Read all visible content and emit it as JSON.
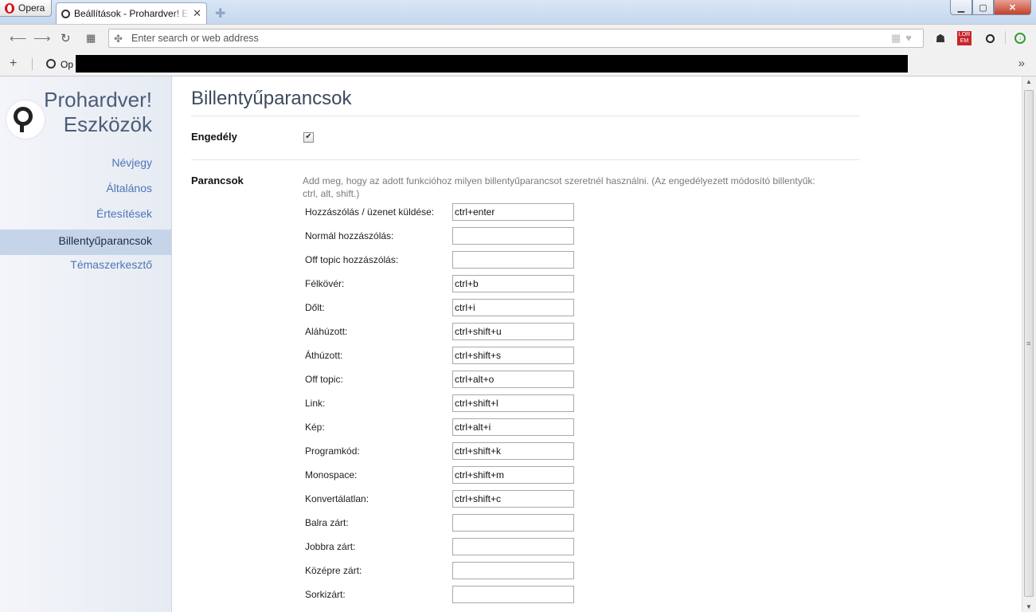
{
  "browser": {
    "opera_label": "Opera",
    "tab_title": "Beállítások - Prohardver! Eszközök",
    "address_placeholder": "Enter search or web address",
    "bookmark_text": "Op",
    "ext_lor_label": "LOR EM"
  },
  "sidebar": {
    "brand_line1": "Prohardver!",
    "brand_line2": "Eszközök",
    "items": [
      {
        "label": "Névjegy",
        "active": false
      },
      {
        "label": "Általános",
        "active": false
      },
      {
        "label": "Értesítések",
        "active": false
      },
      {
        "label": "Billentyűparancsok",
        "active": true
      },
      {
        "label": "Témaszerkesztő",
        "active": false
      }
    ]
  },
  "main": {
    "title": "Billentyűparancsok",
    "enable_label": "Engedély",
    "enable_checked": true,
    "commands_label": "Parancsok",
    "description": "Add meg, hogy az adott funkcióhoz milyen billentyűparancsot szeretnél használni. (Az engedélyezett módosító billentyűk: ctrl, alt, shift.)",
    "shortcuts": [
      {
        "label": "Hozzászólás / üzenet küldése:",
        "value": "ctrl+enter"
      },
      {
        "label": "Normál hozzászólás:",
        "value": ""
      },
      {
        "label": "Off topic hozzászólás:",
        "value": ""
      },
      {
        "label": "Félkövér:",
        "value": "ctrl+b"
      },
      {
        "label": "Dőlt:",
        "value": "ctrl+i"
      },
      {
        "label": "Aláhúzott:",
        "value": "ctrl+shift+u"
      },
      {
        "label": "Áthúzott:",
        "value": "ctrl+shift+s"
      },
      {
        "label": "Off topic:",
        "value": "ctrl+alt+o"
      },
      {
        "label": "Link:",
        "value": "ctrl+shift+l"
      },
      {
        "label": "Kép:",
        "value": "ctrl+alt+i"
      },
      {
        "label": "Programkód:",
        "value": "ctrl+shift+k"
      },
      {
        "label": "Monospace:",
        "value": "ctrl+shift+m"
      },
      {
        "label": "Konvertálatlan:",
        "value": "ctrl+shift+c"
      },
      {
        "label": "Balra zárt:",
        "value": ""
      },
      {
        "label": "Jobbra zárt:",
        "value": ""
      },
      {
        "label": "Középre zárt:",
        "value": ""
      },
      {
        "label": "Sorkizárt:",
        "value": ""
      }
    ]
  },
  "colors": {
    "accent_link": "#4f73b6",
    "active_nav_bg": "#c6d4ea",
    "title_color": "#3d4a5e"
  }
}
